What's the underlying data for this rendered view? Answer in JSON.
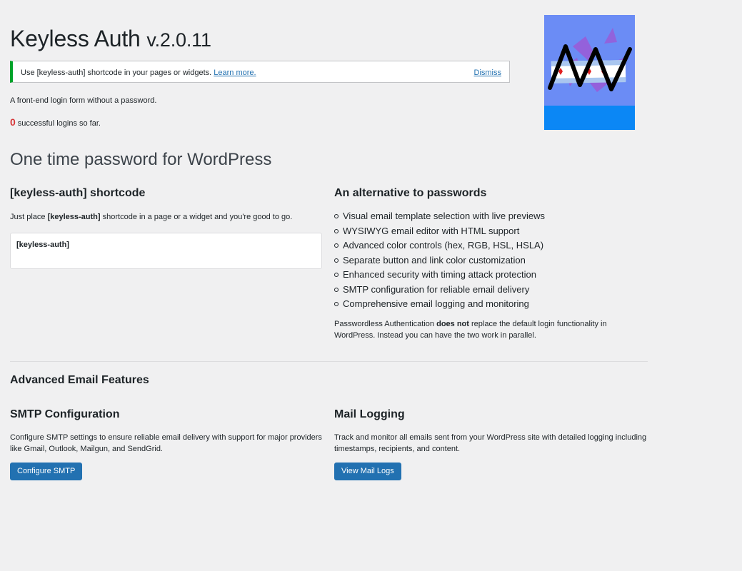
{
  "header": {
    "title": "Keyless Auth",
    "version": "v.2.0.11"
  },
  "notice": {
    "message": "Use [keyless-auth] shortcode in your pages or widgets.",
    "link_label": "Learn more.",
    "dismiss_label": "Dismiss",
    "accent_color": "#00a32a"
  },
  "intro": {
    "tagline": "A front-end login form without a password.",
    "login_count": "0",
    "login_suffix": "successful logins so far."
  },
  "logo": {
    "icon": "keyless-auth-logo-icon",
    "bg_color": "#6b8cf5",
    "footer_color": "#0b87f5"
  },
  "main": {
    "section_title": "One time password for WordPress",
    "shortcode": {
      "heading": "[keyless-auth] shortcode",
      "text_before": "Just place ",
      "text_bold": "[keyless-auth]",
      "text_after": " shortcode in a page or a widget and you're good to go.",
      "code": "[keyless-auth]"
    },
    "alternative": {
      "heading": "An alternative to passwords",
      "features": [
        "Visual email template selection with live previews",
        "WYSIWYG email editor with HTML support",
        "Advanced color controls (hex, RGB, HSL, HSLA)",
        "Separate button and link color customization",
        "Enhanced security with timing attack protection",
        "SMTP configuration for reliable email delivery",
        "Comprehensive email logging and monitoring"
      ],
      "note_before": "Passwordless Authentication ",
      "note_bold": "does not",
      "note_after": " replace the default login functionality in WordPress. Instead you can have the two work in parallel."
    }
  },
  "advanced": {
    "title": "Advanced Email Features",
    "smtp": {
      "heading": "SMTP Configuration",
      "text": "Configure SMTP settings to ensure reliable email delivery with support for major providers like Gmail, Outlook, Mailgun, and SendGrid.",
      "button": "Configure SMTP"
    },
    "logging": {
      "heading": "Mail Logging",
      "text": "Track and monitor all emails sent from your WordPress site with detailed logging including timestamps, recipients, and content.",
      "button": "View Mail Logs"
    },
    "button_color": "#2271b1"
  }
}
